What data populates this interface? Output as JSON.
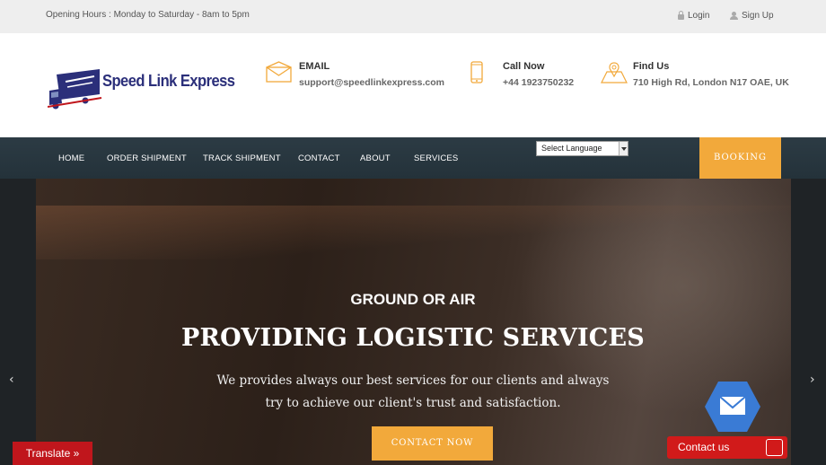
{
  "topbar": {
    "hours": "Opening Hours : Monday to Saturday - 8am to 5pm",
    "login": "Login",
    "signup": "Sign Up"
  },
  "header": {
    "logo_text": "Speed Link Express",
    "email_label": "EMAIL",
    "email_value": "support@speedlinkexpress.com",
    "call_label": "Call Now",
    "call_value": "+44 1923750232",
    "find_label": "Find Us",
    "find_value": "710 High Rd, London N17 OAE, UK"
  },
  "nav": {
    "items": [
      "HOME",
      "ORDER SHIPMENT",
      "TRACK SHIPMENT",
      "CONTACT",
      "ABOUT",
      "SERVICES"
    ],
    "language_select": "Select Language",
    "booking": "BOOKING"
  },
  "hero": {
    "subtitle": "GROUND OR AIR",
    "title": "PROVIDING LOGISTIC SERVICES",
    "desc_line1": "We provides always our best services for our clients and always",
    "desc_line2": "try to achieve our client's trust and satisfaction.",
    "cta": "CONTACT NOW",
    "prev": "‹",
    "next": "›"
  },
  "widgets": {
    "translate": "Translate »",
    "contact_us": "Contact us"
  },
  "colors": {
    "accent": "#f2a93b",
    "nav_bg": "#2c3b44",
    "logo_blue": "#2b2f7a",
    "widget_red": "#d11a1a",
    "mail_hex": "#3a7bd5"
  },
  "icons": [
    "lock-icon",
    "user-icon",
    "envelope-icon",
    "phone-icon",
    "map-icon",
    "mail-icon"
  ]
}
